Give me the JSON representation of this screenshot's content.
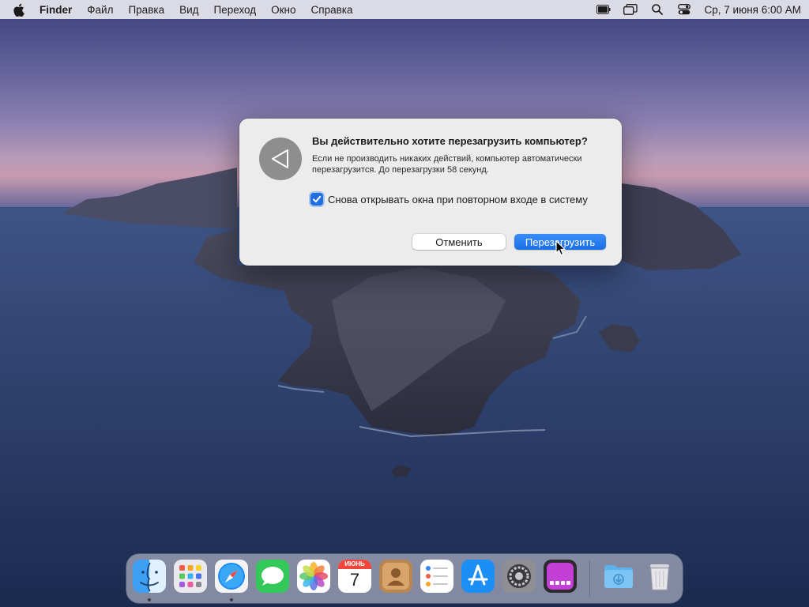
{
  "menubar": {
    "app_name": "Finder",
    "items": [
      "Файл",
      "Правка",
      "Вид",
      "Переход",
      "Окно",
      "Справка"
    ],
    "clock": "Ср, 7 июня  6:00 AM",
    "status_icons": [
      "battery-icon",
      "screen-mirroring-icon",
      "spotlight-search-icon",
      "control-center-icon"
    ]
  },
  "dialog": {
    "title": "Вы действительно хотите перезагрузить компьютер?",
    "message": "Если не производить никаких действий, компьютер автоматически перезагрузится. До перезагрузки 58 секунд.",
    "checkbox_label": "Снова открывать окна при повторном входе в систему",
    "checkbox_checked": true,
    "cancel_label": "Отменить",
    "restart_label": "Перезагрузить"
  },
  "dock": {
    "calendar_month": "ИЮНЬ",
    "calendar_day": "7",
    "apps": [
      "finder-icon",
      "launchpad-icon",
      "safari-icon",
      "messages-icon",
      "photos-icon",
      "calendar-icon",
      "contacts-icon",
      "reminders-icon",
      "app-store-icon",
      "system-preferences-icon",
      "podcasts-icon",
      "downloads-folder-icon",
      "trash-icon"
    ]
  },
  "colors": {
    "accent": "#1f6fe0",
    "dialog_bg": "#ececec"
  }
}
